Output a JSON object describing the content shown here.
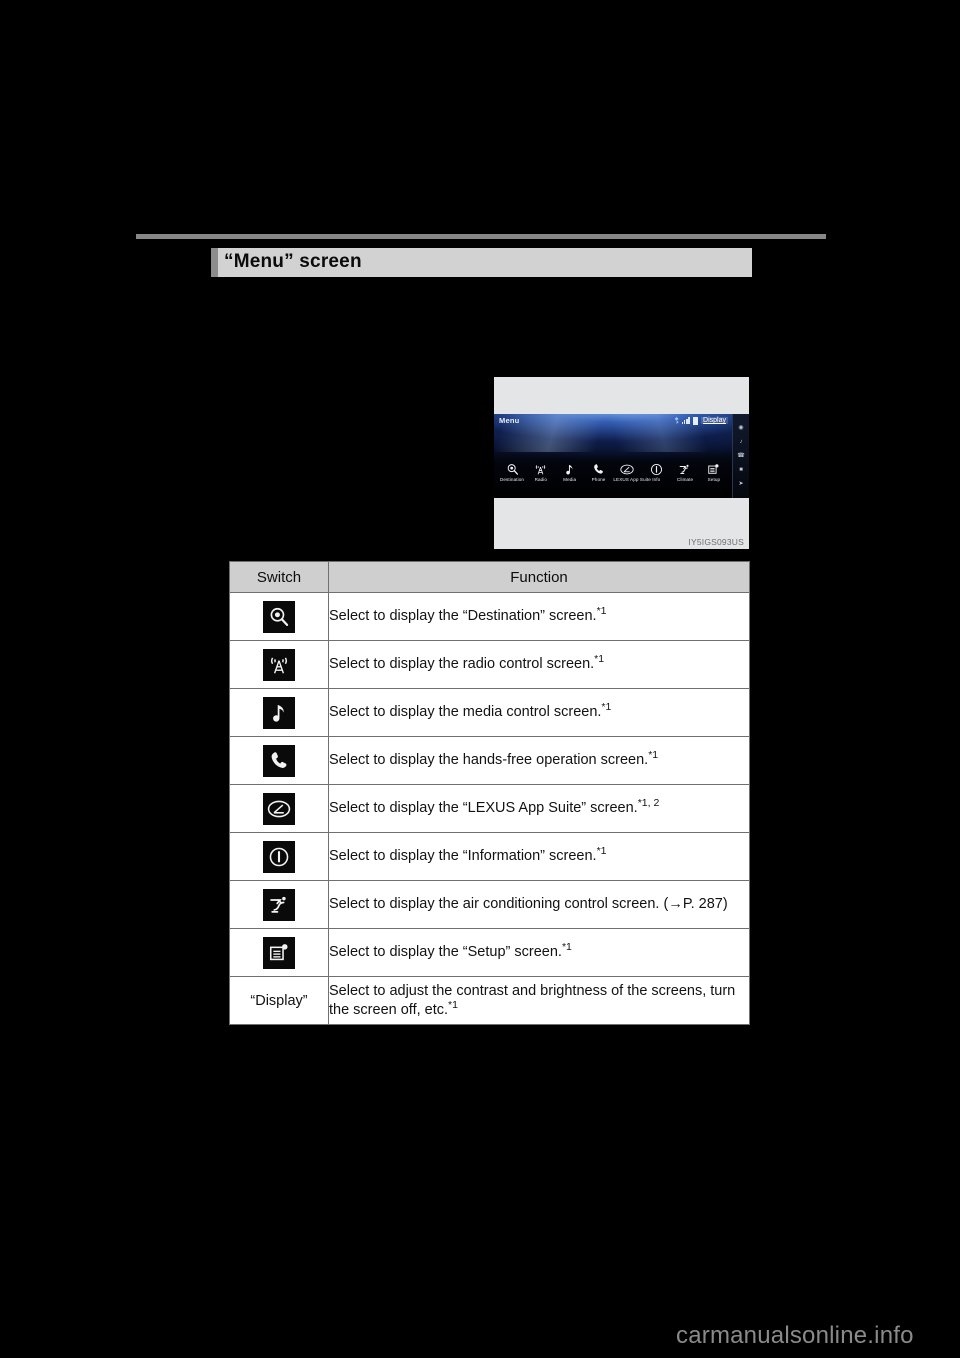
{
  "section": {
    "title": "“Menu” screen"
  },
  "figure": {
    "caption": "IY5IGS093US",
    "screen": {
      "title": "Menu",
      "status": {
        "bluetooth_icon": "bluetooth-icon",
        "signal_icon": "signal-bars-icon",
        "battery_icon": "battery-icon",
        "display_label": "Display"
      },
      "items": [
        {
          "label": "Destination",
          "icon": "destination-icon"
        },
        {
          "label": "Radio",
          "icon": "radio-tower-icon"
        },
        {
          "label": "Media",
          "icon": "music-note-icon"
        },
        {
          "label": "Phone",
          "icon": "phone-handset-icon"
        },
        {
          "label": "LEXUS App Suite",
          "icon": "lexus-logo-icon"
        },
        {
          "label": "Info",
          "icon": "info-circle-icon"
        },
        {
          "label": "Climate",
          "icon": "climate-seat-icon"
        },
        {
          "label": "Setup",
          "icon": "setup-gear-icon"
        }
      ],
      "side_icons": [
        "destination-side-icon",
        "media-side-icon",
        "phone-side-icon",
        "info-side-icon",
        "climate-side-icon"
      ]
    }
  },
  "table": {
    "headers": {
      "switch": "Switch",
      "function": "Function"
    },
    "rows": [
      {
        "icon": "destination-icon",
        "switch_label": "",
        "function": "Select to display the “Destination” screen.",
        "footnote": "*1"
      },
      {
        "icon": "radio-tower-icon",
        "switch_label": "",
        "function": "Select to display the radio control screen.",
        "footnote": "*1"
      },
      {
        "icon": "music-note-icon",
        "switch_label": "",
        "function": "Select to display the media control screen.",
        "footnote": "*1"
      },
      {
        "icon": "phone-handset-icon",
        "switch_label": "",
        "function": "Select to display the hands-free operation screen.",
        "footnote": "*1"
      },
      {
        "icon": "lexus-logo-icon",
        "switch_label": "",
        "function": "Select to display the “LEXUS App Suite” screen.",
        "footnote": "*1, 2"
      },
      {
        "icon": "info-circle-icon",
        "switch_label": "",
        "function": "Select to display the “Information” screen.",
        "footnote": "*1"
      },
      {
        "icon": "climate-seat-icon",
        "switch_label": "",
        "function": "Select to display the air conditioning control screen. (→P. 287)",
        "footnote": ""
      },
      {
        "icon": "setup-gear-icon",
        "switch_label": "",
        "function": "Select to display the “Setup” screen.",
        "footnote": "*1"
      },
      {
        "icon": "",
        "switch_label": "“Display”",
        "function": "Select to adjust the contrast and brightness of the screens, turn the screen off, etc.",
        "footnote": "*1"
      }
    ]
  },
  "watermark": "carmanualsonline.info",
  "colors": {
    "page_background": "#000000",
    "heading_bar": "#d2d2d2",
    "heading_tab": "#8c8c8c",
    "table_header": "#cfcfcf",
    "table_border": "#6f7072",
    "figure_background": "#e3e5e6",
    "icon_tile": "#0a0a0a"
  }
}
